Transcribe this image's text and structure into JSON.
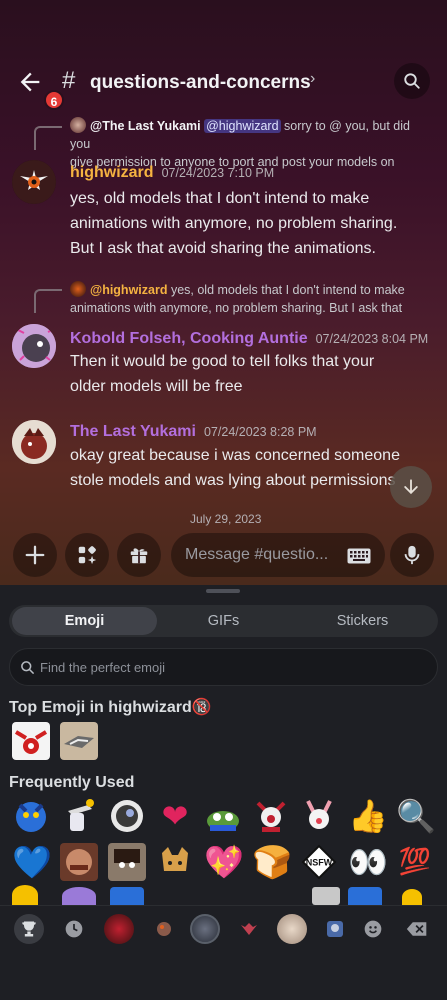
{
  "header": {
    "notification_count": "6",
    "hash_symbol": "#",
    "channel_name": "questions-and-concerns",
    "chevron": "›"
  },
  "messages": [
    {
      "reply": {
        "name": "@The Last Yukami",
        "mention": "@highwizard",
        "text_line1": "sorry to @ you, but did you",
        "text_line2": "give permission to anyone to port and post your models on"
      },
      "author": "highwizard",
      "author_color": "#f5b341",
      "time": "07/24/2023 7:10 PM",
      "lines": [
        "yes, old models that I don't intend to make",
        "animations with anymore, no problem sharing.",
        "But I ask that avoid sharing the animations."
      ]
    },
    {
      "reply": {
        "name": "@highwizard",
        "text_line1": "yes, old models that I don't intend to make",
        "text_line2": "animations with anymore, no problem sharing. But I ask that"
      },
      "author": "Kobold Folseh, Cooking Auntie",
      "author_color": "#b36fdd",
      "time": "07/24/2023 8:04 PM",
      "lines": [
        "Then it would be good to tell folks that your",
        "older models will be free"
      ]
    },
    {
      "author": "The Last Yukami",
      "author_color": "#b36fdd",
      "time": "07/24/2023 8:28 PM",
      "lines": [
        "okay great because i was concerned someone",
        "stole models and was lying about permissions"
      ]
    }
  ],
  "date_divider": "July 29, 2023",
  "input": {
    "placeholder": "Message #questio..."
  },
  "picker": {
    "tabs": [
      "Emoji",
      "GIFs",
      "Stickers"
    ],
    "active_tab": "Emoji",
    "search_placeholder": "Find the perfect emoji",
    "top_emoji_title": "Top Emoji in highwizard",
    "top_emoji_badge": "🔞",
    "frequent_title": "Frequently Used",
    "row1": [
      "custom",
      "custom",
      "custom",
      "❤",
      "custom",
      "custom",
      "custom",
      "👍",
      "🔍"
    ],
    "row2": [
      "💙",
      "custom",
      "custom",
      "custom",
      "💖",
      "🍞",
      "NSFW",
      "👀",
      "💯"
    ]
  },
  "colors": {
    "accent": "#5865f2",
    "highwizard": "#f5b341",
    "purple_name": "#b36fdd",
    "heart_red": "#e0245e"
  }
}
